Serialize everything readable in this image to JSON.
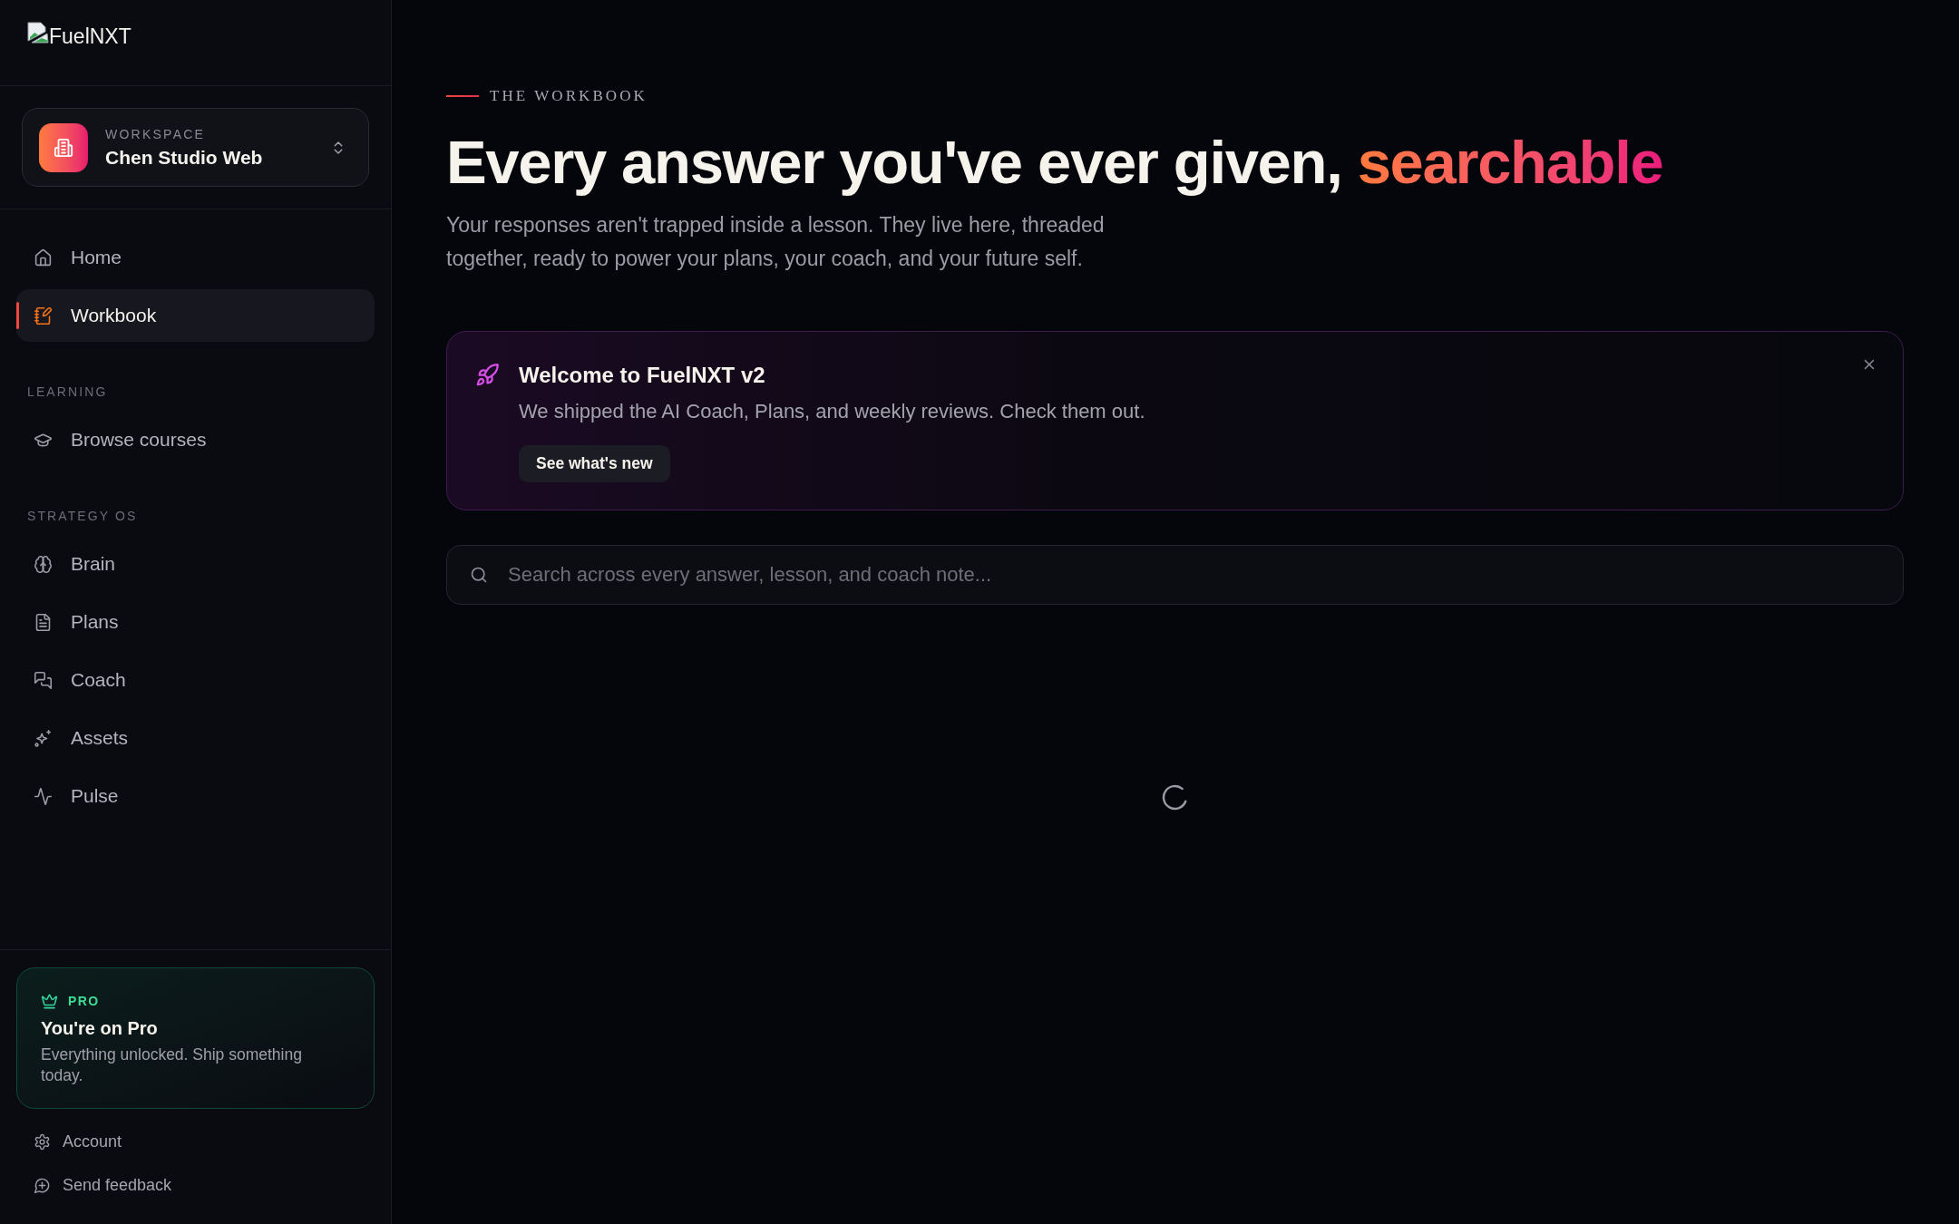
{
  "sidebar": {
    "logo": {
      "alt_text": "FuelNXT"
    },
    "workspace": {
      "label": "WORKSPACE",
      "name": "Chen Studio Web"
    },
    "nav": {
      "items": [
        {
          "label": "Home",
          "selected": false
        },
        {
          "label": "Workbook",
          "selected": true
        }
      ],
      "sections": [
        {
          "title": "LEARNING",
          "items": [
            {
              "label": "Browse courses",
              "selected": false
            }
          ]
        },
        {
          "title": "STRATEGY OS",
          "items": [
            {
              "label": "Brain",
              "selected": false
            },
            {
              "label": "Plans",
              "selected": false
            },
            {
              "label": "Coach",
              "selected": false
            },
            {
              "label": "Assets",
              "selected": false
            },
            {
              "label": "Pulse",
              "selected": false
            }
          ]
        }
      ]
    },
    "plan_card": {
      "badge": "PRO",
      "title": "You're on Pro",
      "description": "Everything unlocked. Ship something today."
    },
    "footer_links": [
      "Account",
      "Send feedback"
    ]
  },
  "main": {
    "eyebrow": "THE WORKBOOK",
    "title": {
      "text": "Every answer you've ever given,",
      "highlight": "searchable"
    },
    "description": "Your responses aren't trapped inside a lesson. They live here, threaded together, ready to power your plans, your coach, and your future self.",
    "announcement": {
      "title": "Welcome to FuelNXT v2",
      "text": "We shipped the AI Coach, Plans, and weekly reviews. Check them out.",
      "button": "See what's new"
    },
    "search": {
      "placeholder": "Search across every answer, lesson, and coach note..."
    },
    "loading": true
  }
}
